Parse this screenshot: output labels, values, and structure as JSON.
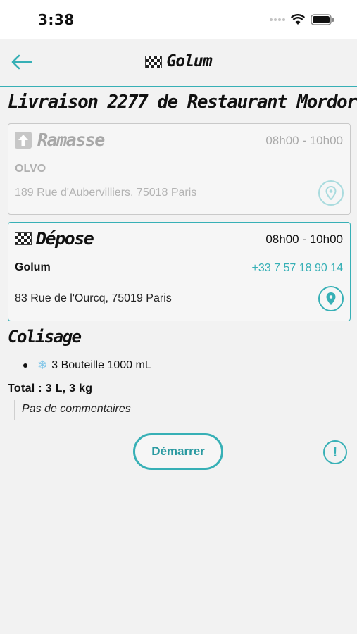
{
  "status_bar": {
    "time": "3:38"
  },
  "header": {
    "title": "Golum",
    "back_icon": "arrow-left-icon"
  },
  "page_title": "Livraison 2277 de Restaurant Mordor",
  "pickup": {
    "title": "Ramasse",
    "time": "08h00 - 10h00",
    "name": "OLVO",
    "address": "189 Rue d'Aubervilliers, 75018 Paris"
  },
  "drop": {
    "title": "Dépose",
    "time": "08h00 - 10h00",
    "name": "Golum",
    "phone": "+33 7 57 18 90 14",
    "address": "83 Rue de l'Ourcq, 75019 Paris"
  },
  "colisage": {
    "title": "Colisage",
    "items": [
      {
        "label": "3 Bouteille 1000 mL",
        "icon": "snowflake-icon"
      }
    ],
    "total": "Total : 3 L, 3 kg",
    "comment": "Pas de commentaires"
  },
  "actions": {
    "start_label": "Démarrer",
    "alert_icon": "alert-circle-icon"
  },
  "colors": {
    "accent": "#37b0b6",
    "disabled": "#b0b0b0"
  }
}
